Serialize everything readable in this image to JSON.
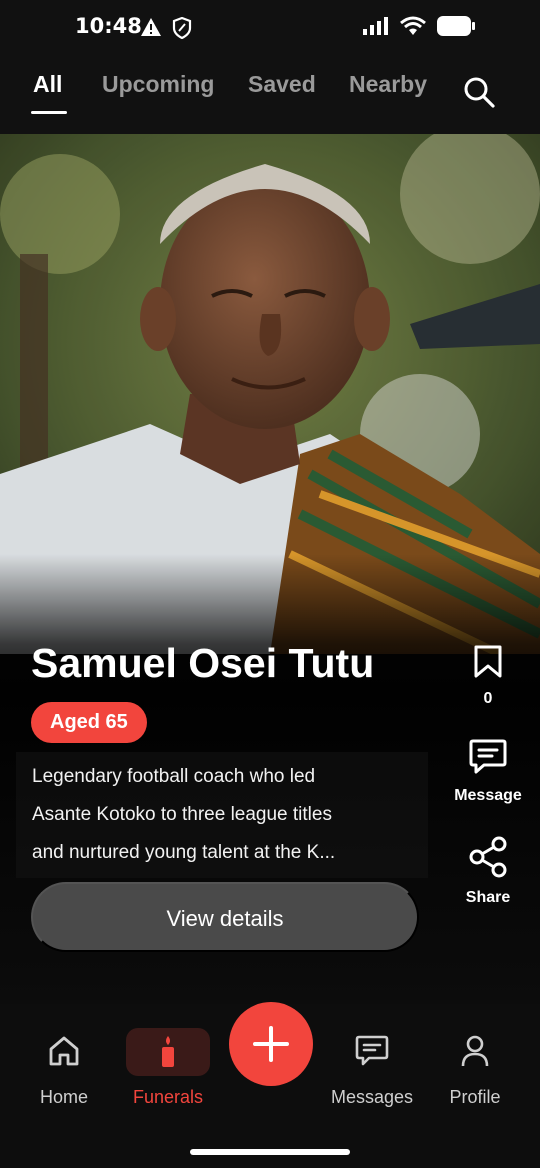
{
  "status_bar": {
    "time": "10:48"
  },
  "tabs": [
    {
      "label": "All",
      "active": true
    },
    {
      "label": "Upcoming",
      "active": false
    },
    {
      "label": "Saved",
      "active": false
    },
    {
      "label": "Nearby",
      "active": false
    }
  ],
  "profile": {
    "name": "Samuel Osei Tutu",
    "age_label": "Aged 65",
    "description_lines": [
      "Legendary football coach who led",
      "Asante Kotoko to three league titles",
      "and nurtured young talent at the K..."
    ],
    "view_details_label": "View details"
  },
  "actions": {
    "bookmark_count": "0",
    "message_label": "Message",
    "share_label": "Share"
  },
  "bottom_nav": [
    {
      "label": "Home",
      "active": false
    },
    {
      "label": "Funerals",
      "active": true
    },
    {
      "label": "Messages",
      "active": false
    },
    {
      "label": "Profile",
      "active": false
    }
  ],
  "colors": {
    "accent": "#f2453d",
    "background": "#0d0d0d"
  }
}
